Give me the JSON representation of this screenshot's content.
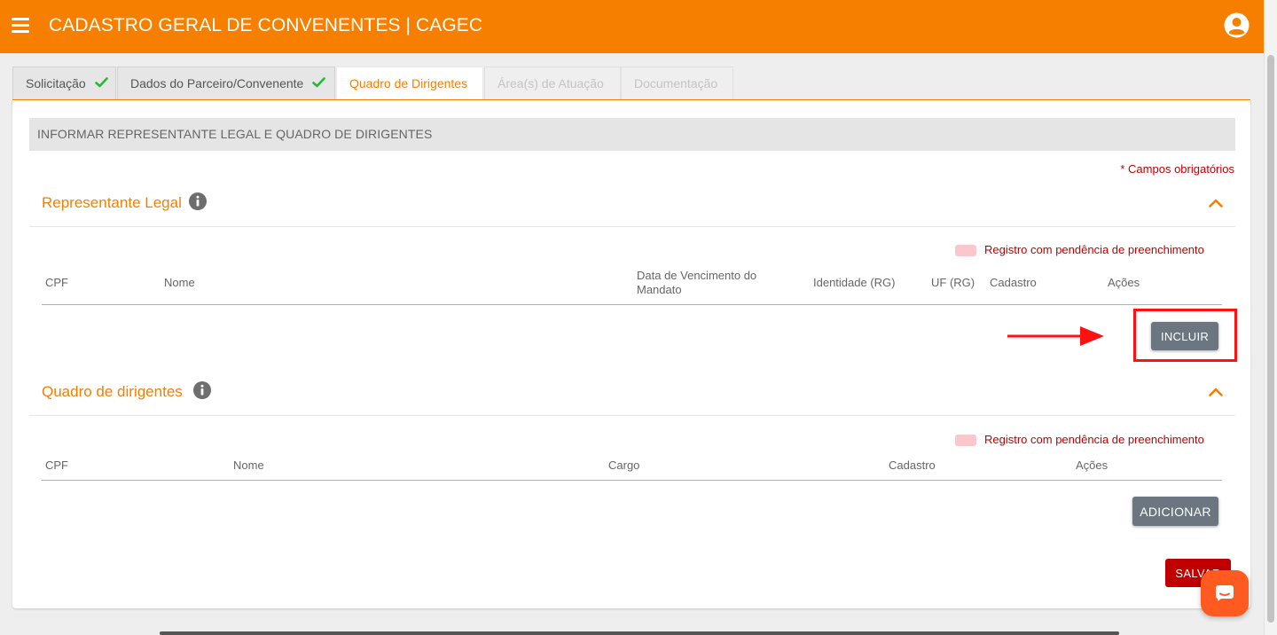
{
  "app": {
    "title": "CADASTRO GERAL DE CONVENENTES | CAGEC",
    "brand_color": "#f67f00"
  },
  "tabs": [
    {
      "label": "Solicitação",
      "state": "completed"
    },
    {
      "label": "Dados do Parceiro/Convenente",
      "state": "completed"
    },
    {
      "label": "Quadro de Dirigentes",
      "state": "active"
    },
    {
      "label": "Área(s) de Atuação",
      "state": "disabled"
    },
    {
      "label": "Documentação",
      "state": "disabled"
    }
  ],
  "form": {
    "banner": "INFORMAR REPRESENTANTE LEGAL E QUADRO DE DIRIGENTES",
    "required_note": "* Campos obrigatórios",
    "save_label": "SALVAR"
  },
  "representante": {
    "title": "Representante Legal",
    "legend": "Registro com pendência de preenchimento",
    "columns": [
      "CPF",
      "Nome",
      "Data de Vencimento do Mandato",
      "Identidade (RG)",
      "UF (RG)",
      "Cadastro",
      "Ações"
    ],
    "rows": [],
    "add_label": "INCLUIR"
  },
  "dirigentes": {
    "title": "Quadro de dirigentes",
    "legend": "Registro com pendência de preenchimento",
    "columns": [
      "CPF",
      "Nome",
      "Cargo",
      "Cadastro",
      "Ações"
    ],
    "rows": [],
    "add_label": "ADICIONAR"
  },
  "colors": {
    "accent": "#f67f00",
    "required": "#c00000",
    "pending_swatch": "#f9c7cc",
    "button": "#6b7680",
    "annotation": "#ff1111"
  },
  "icons": [
    "menu-icon",
    "account-icon",
    "check-icon",
    "info-icon",
    "chevron-up-icon",
    "chat-icon"
  ]
}
